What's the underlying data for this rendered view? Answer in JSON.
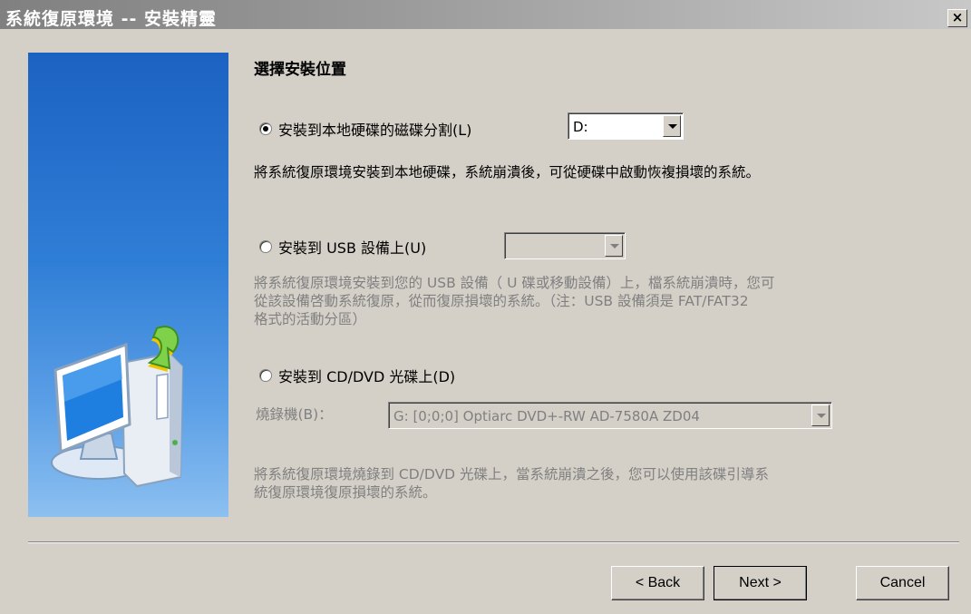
{
  "window": {
    "title": "系統復原環境 -- 安裝精靈",
    "close_glyph": "×"
  },
  "heading": "選擇安裝位置",
  "options": {
    "local_disk": {
      "label": "安裝到本地硬碟的磁碟分割(L)",
      "selected": true,
      "combo_value": "D:",
      "description": "將系統復原環境安裝到本地硬碟，系統崩潰後，可從硬碟中啟動恢複損壞的系統。"
    },
    "usb": {
      "label": "安裝到 USB 設備上(U)",
      "selected": false,
      "combo_value": "",
      "description_lines": [
        "將系統復原環境安裝到您的 USB 設備（ U 碟或移動設備）上，檔系統崩潰時，您可",
        "從該設備啓動系統復原，從而復原損壞的系統。（注：USB 設備須是 FAT/FAT32",
        "格式的活動分區）"
      ]
    },
    "cd_dvd": {
      "label": "安裝到 CD/DVD 光碟上(D)",
      "selected": false,
      "burner_label": "燒錄機(B)：",
      "burner_value": "G:  [0;0;0] Optiarc  DVD+-RW AD-7580A ZD04",
      "description_lines": [
        "將系統復原環境燒錄到 CD/DVD 光碟上，當系統崩潰之後，您可以使用該碟引導系",
        "統復原環境復原損壞的系統。"
      ]
    }
  },
  "buttons": {
    "back": "< Back",
    "next": "Next >",
    "cancel": "Cancel"
  }
}
